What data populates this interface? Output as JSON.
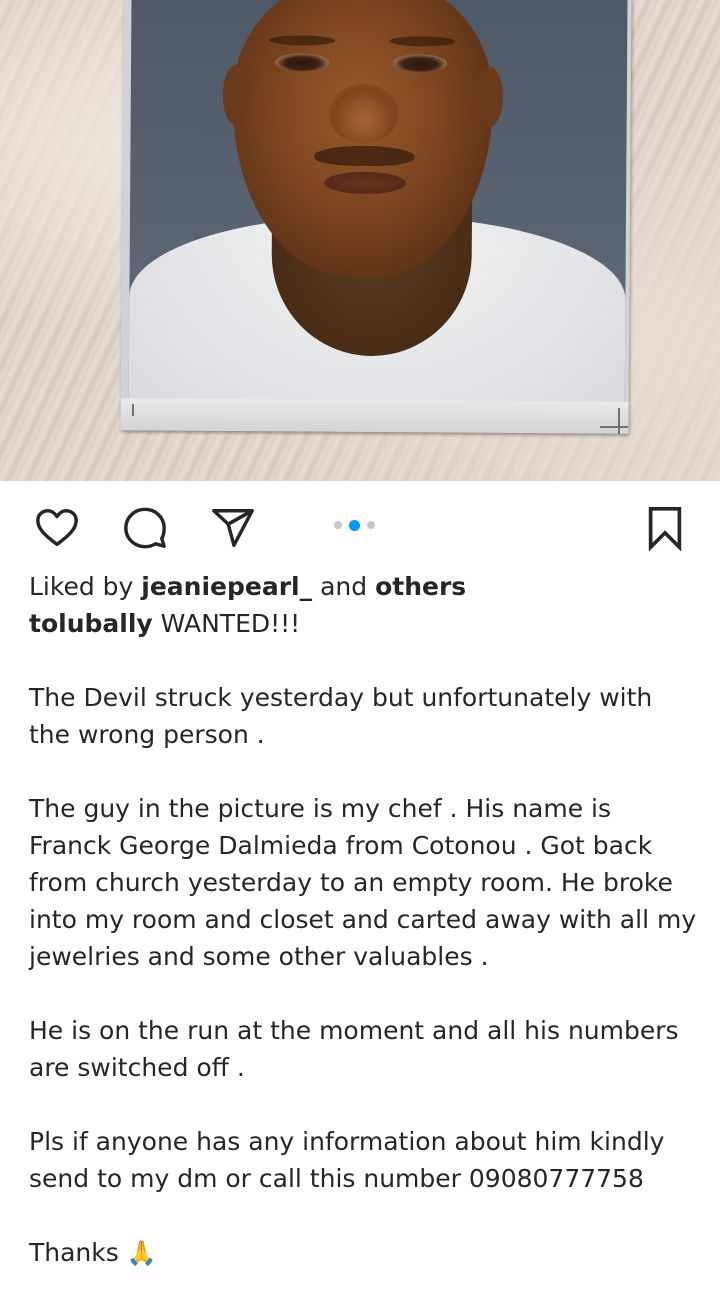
{
  "post": {
    "image_alt": "Photograph of a printed portrait pinned to a textured wall",
    "carousel": {
      "count": 3,
      "active_index": 1
    }
  },
  "actions": {
    "like_icon": "heart-icon",
    "comment_icon": "comment-icon",
    "share_icon": "send-icon",
    "save_icon": "bookmark-icon",
    "accent_color": "#0095f6"
  },
  "likes": {
    "prefix": "Liked by",
    "user": "jeaniepearl_",
    "connector": "and",
    "others": "others"
  },
  "caption": {
    "author": "tolubally",
    "headline": "WANTED!!!",
    "paragraphs": [
      "The Devil struck yesterday but unfortunately with the wrong person .",
      "The guy in the picture is my chef . His name is Franck George Dalmieda from Cotonou . Got back from church yesterday to an empty room. He broke into my room and closet and carted away with all my jewelries and some other valuables .",
      "He is on the run at the moment and all his numbers are switched off .",
      "Pls if anyone has any information about him kindly send to my dm or call this number 09080777758"
    ],
    "closing": "Thanks",
    "closing_emoji": "🙏"
  }
}
